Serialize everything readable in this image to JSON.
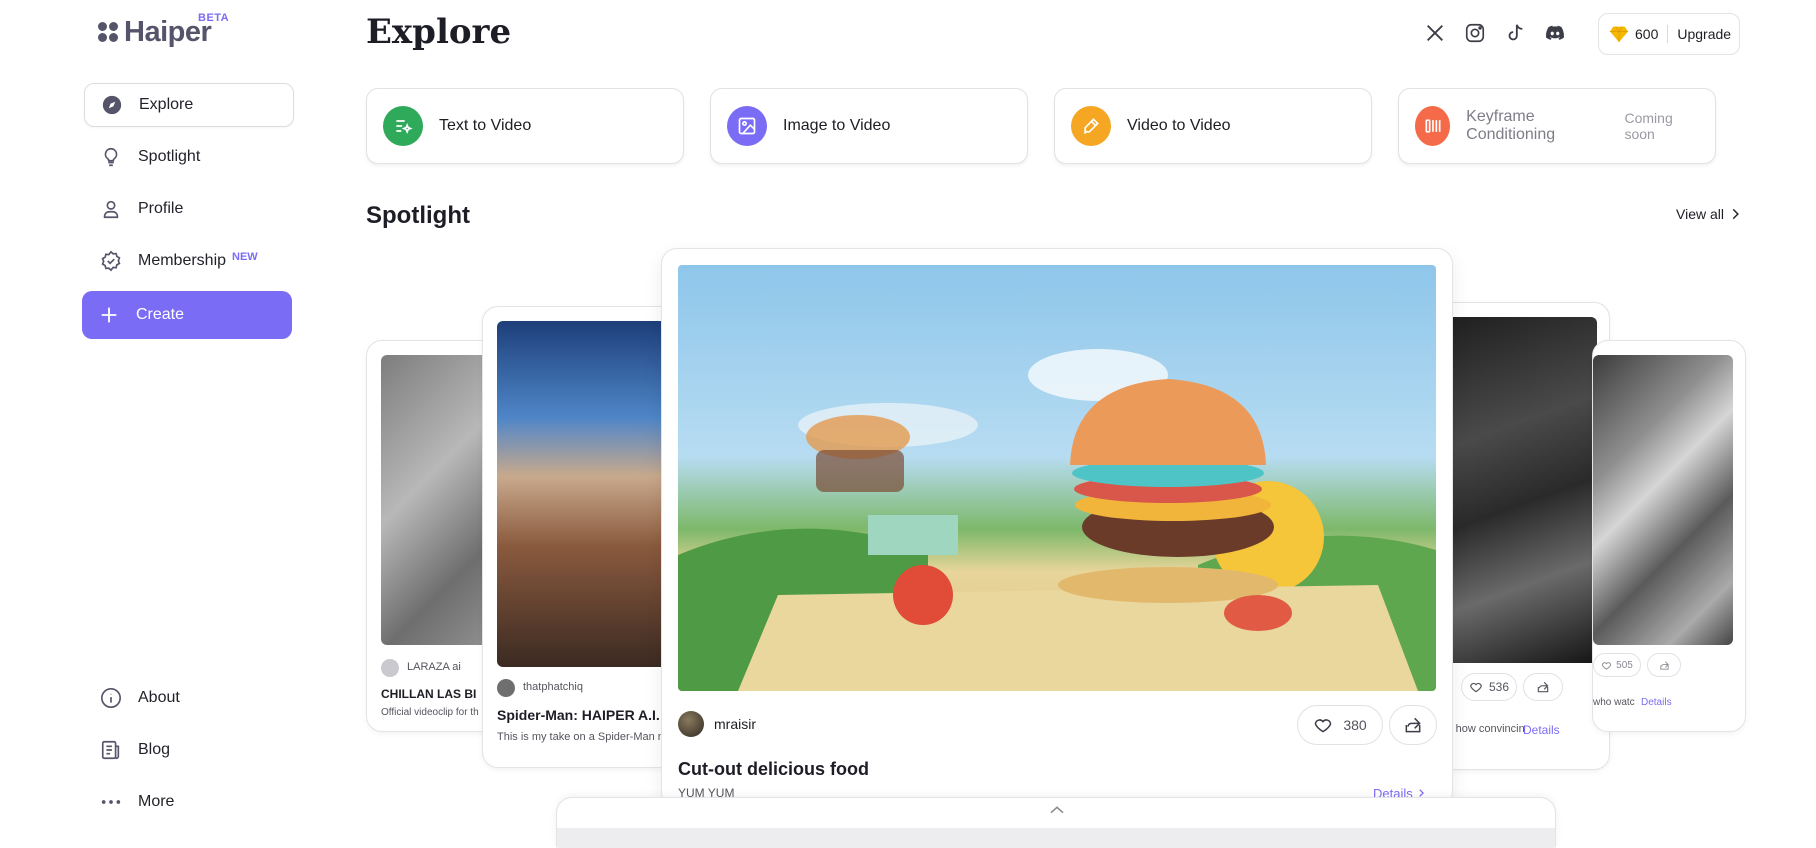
{
  "app": {
    "name": "Haiper",
    "badge": "BETA"
  },
  "sidebar": {
    "items": [
      {
        "label": "Explore",
        "icon": "compass-icon",
        "active": true
      },
      {
        "label": "Spotlight",
        "icon": "lightbulb-icon"
      },
      {
        "label": "Profile",
        "icon": "user-icon"
      },
      {
        "label": "Membership",
        "icon": "badge-icon",
        "badge": "NEW"
      },
      {
        "label": "Create",
        "icon": "plus-icon"
      }
    ],
    "bottom": [
      {
        "label": "About",
        "icon": "info-icon"
      },
      {
        "label": "Blog",
        "icon": "blog-icon"
      },
      {
        "label": "More",
        "icon": "more-dots-icon"
      }
    ]
  },
  "header": {
    "title": "Explore",
    "socials": [
      "x-icon",
      "instagram-icon",
      "tiktok-icon",
      "discord-icon"
    ],
    "credits": "600",
    "upgrade": "Upgrade"
  },
  "modes": [
    {
      "label": "Text to Video",
      "color": "#2fa95a",
      "icon": "text-sparkle-icon"
    },
    {
      "label": "Image to Video",
      "color": "#7b6cf6",
      "icon": "image-icon"
    },
    {
      "label": "Video to Video",
      "color": "#f5a623",
      "icon": "pencil-icon"
    },
    {
      "label": "Keyframe Conditioning",
      "color": "#f56b4a",
      "icon": "keyframe-icon",
      "status": "Coming soon"
    }
  ],
  "spotlight": {
    "title": "Spotlight",
    "view_all": "View all",
    "cards": [
      {
        "author": "LARAZA ai",
        "title": "CHILLAN LAS BI",
        "desc": "Official videoclip for th"
      },
      {
        "author": "thatphatchiq",
        "title": "Spider-Man: HAIPER A.I.",
        "desc": "This is my take on a Spider-Man n"
      },
      {
        "author": "mraisir",
        "likes": "380",
        "title": "Cut-out delicious food",
        "desc": "YUM YUM",
        "details": "Details"
      },
      {
        "likes": "536",
        "desc": "amazing how convincin",
        "details": "Details"
      },
      {
        "likes": "505",
        "desc": "who watc",
        "details": "Details"
      }
    ]
  },
  "colors": {
    "accent": "#7b6cf6",
    "text": "#1d1d25",
    "border": "#e3e3e8"
  }
}
